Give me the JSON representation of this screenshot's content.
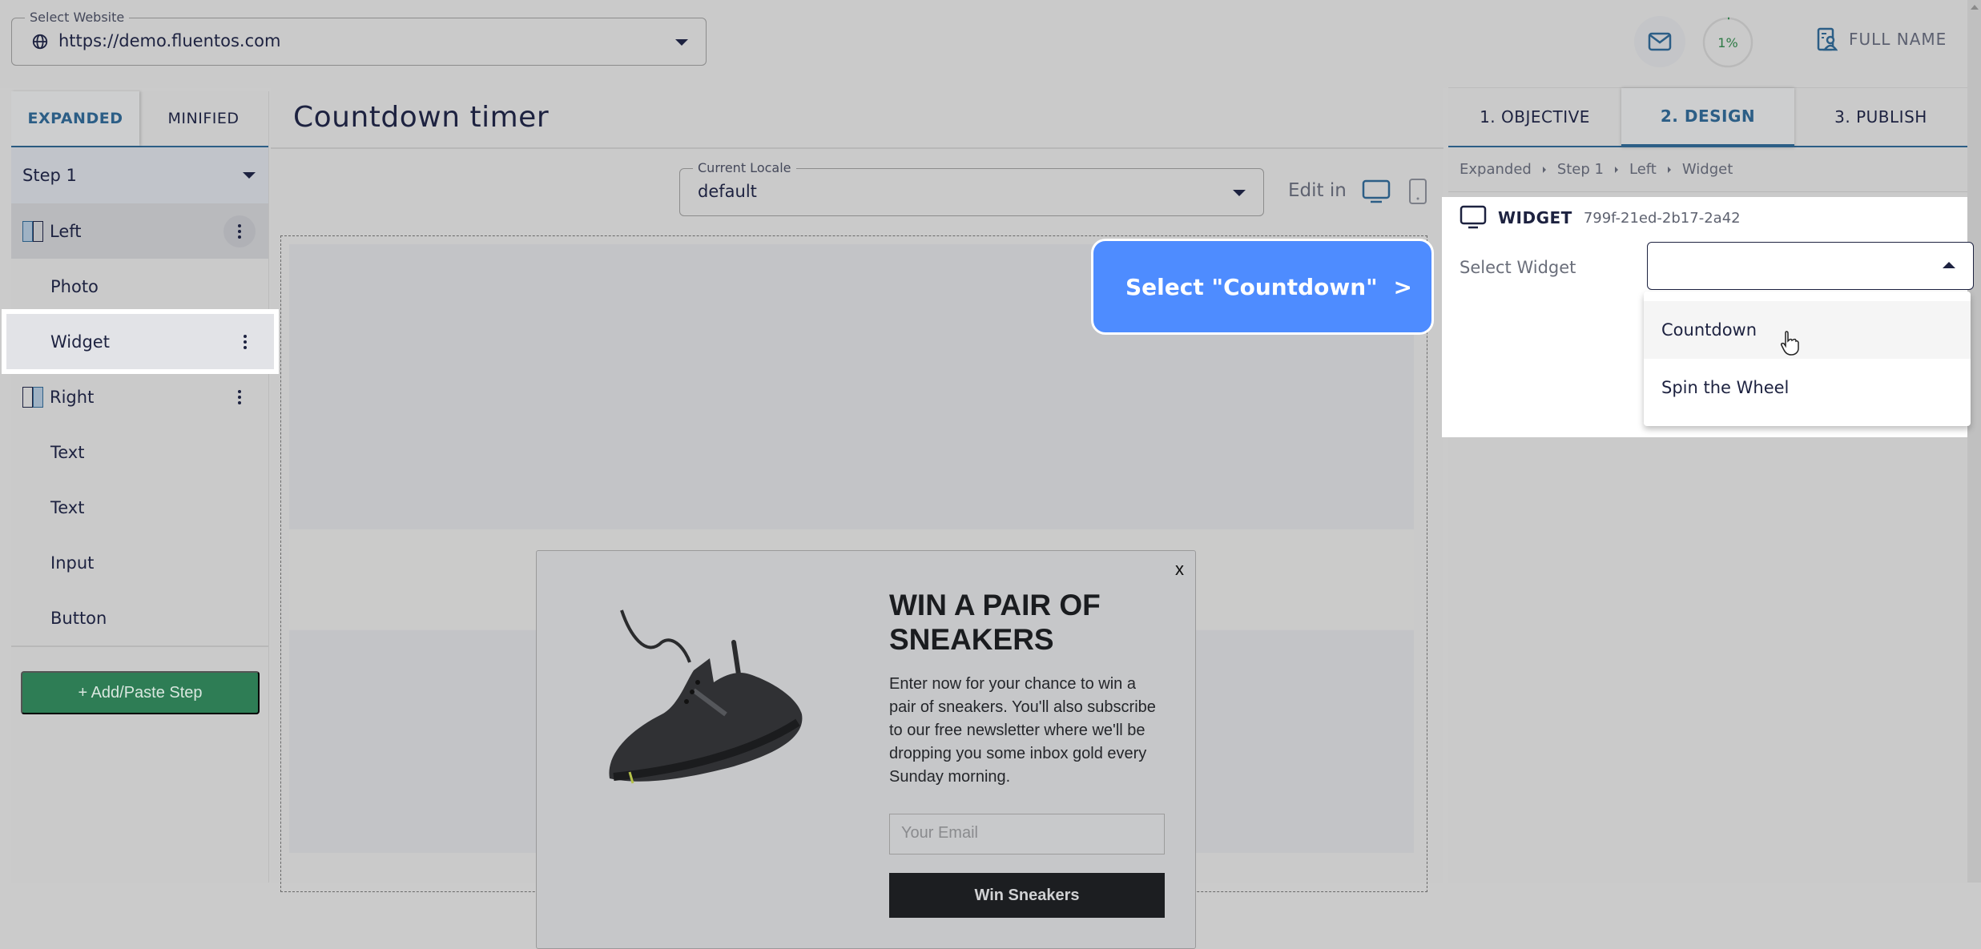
{
  "header": {
    "website_select": {
      "label": "Select Website",
      "value": "https://demo.fluentos.com",
      "icon": "globe-icon"
    },
    "mail_icon": "mail-icon",
    "progress": {
      "percent": 1,
      "label": "1%"
    },
    "user": {
      "icon": "contact-card-icon",
      "label": "FULL NAME"
    }
  },
  "sidebar": {
    "tabs": [
      {
        "label": "EXPANDED",
        "active": true
      },
      {
        "label": "MINIFIED",
        "active": false
      }
    ],
    "step": {
      "label": "Step 1"
    },
    "items": [
      {
        "label": "Left",
        "type": "group",
        "icon": "column-left-icon",
        "selected": true,
        "menu": true
      },
      {
        "label": "Photo",
        "type": "child"
      },
      {
        "label": "Widget",
        "type": "child",
        "highlighted": true,
        "menu": true
      },
      {
        "label": "Right",
        "type": "group",
        "icon": "column-right-icon",
        "menu": true
      },
      {
        "label": "Text",
        "type": "child"
      },
      {
        "label": "Text",
        "type": "child"
      },
      {
        "label": "Input",
        "type": "child"
      },
      {
        "label": "Button",
        "type": "child"
      }
    ],
    "add_step_label": "+ Add/Paste Step"
  },
  "center": {
    "title": "Countdown timer",
    "locale": {
      "label": "Current Locale",
      "value": "default"
    },
    "edit_in_label": "Edit in",
    "device_options": [
      "desktop",
      "mobile"
    ],
    "active_device": "desktop",
    "hint": {
      "text": "Select \"Countdown\"",
      "arrow": ">"
    },
    "popup": {
      "close": "x",
      "heading": "WIN A PAIR OF SNEAKERS",
      "body": "Enter now for your chance to win a pair of sneakers. You'll also subscribe to our free newsletter where we'll be dropping you some inbox gold every Sunday morning.",
      "email_placeholder": "Your Email",
      "button_label": "Win Sneakers"
    }
  },
  "right_panel": {
    "tabs": [
      {
        "label": "1. OBJECTIVE",
        "active": false
      },
      {
        "label": "2. DESIGN",
        "active": true
      },
      {
        "label": "3. PUBLISH",
        "active": false
      }
    ],
    "breadcrumb": [
      "Expanded",
      "Step 1",
      "Left",
      "Widget"
    ],
    "widget": {
      "title": "WIDGET",
      "id": "799f-21ed-2b17-2a42",
      "select_label": "Select Widget",
      "select_value": "",
      "options": [
        {
          "label": "Countdown",
          "hovered": true
        },
        {
          "label": "Spin the Wheel",
          "hovered": false
        }
      ]
    }
  },
  "colors": {
    "accent": "#2c5e86",
    "hint_blue": "#4e8cff",
    "add_step_green": "#2e7d55",
    "progress_green": "#2d7a45"
  }
}
